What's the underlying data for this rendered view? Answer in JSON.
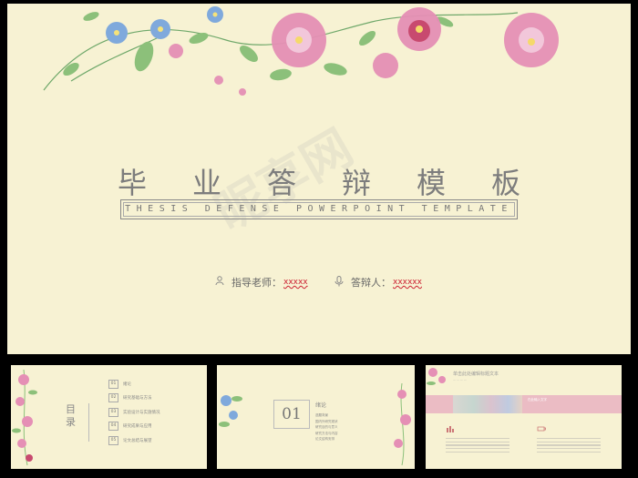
{
  "main_slide": {
    "title": "毕业答辩模板",
    "subtitle": "THESIS DEFENSE POWERPOINT TEMPLATE",
    "advisor_label": "指导老师：",
    "advisor_value": "xxxxx",
    "defender_label": "答辩人：",
    "defender_value": "xxxxxx",
    "watermark": "昵享网"
  },
  "thumbnails": {
    "toc": {
      "title": "目录",
      "items": [
        {
          "num": "01",
          "label": "绪论"
        },
        {
          "num": "02",
          "label": "研究基础与方法"
        },
        {
          "num": "03",
          "label": "实验设计与实施情况"
        },
        {
          "num": "04",
          "label": "研究成果与应用"
        },
        {
          "num": "05",
          "label": "论文总结与展望"
        }
      ]
    },
    "section": {
      "number": "01",
      "heading": "绪论",
      "items": [
        "选题背景",
        "国内外研究现状",
        "研究目的与意义",
        "研究方法与内容",
        "论文结构安排"
      ]
    },
    "content": {
      "heading": "单击此处编辑标题文本",
      "band_text": "在此输入文字"
    }
  },
  "colors": {
    "background": "#f7f2d3",
    "pink_accent": "#ebbcc4",
    "text_gray": "#7d7d7d"
  }
}
